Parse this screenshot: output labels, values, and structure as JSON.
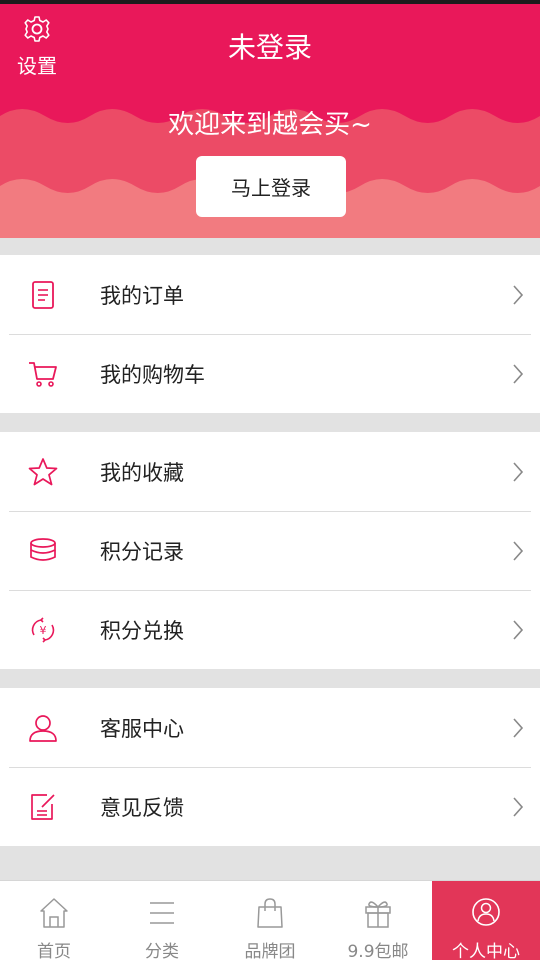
{
  "header": {
    "title": "未登录",
    "settings_label": "设置",
    "welcome": "欢迎来到越会买~",
    "login_button": "马上登录",
    "colors": {
      "primary": "#e9185a",
      "wave_mid": "#ec4b66",
      "wave_light": "#f27b80"
    }
  },
  "menu": {
    "group1": [
      {
        "label": "我的订单",
        "icon": "order-icon"
      },
      {
        "label": "我的购物车",
        "icon": "cart-icon"
      }
    ],
    "group2": [
      {
        "label": "我的收藏",
        "icon": "star-icon"
      },
      {
        "label": "积分记录",
        "icon": "coins-icon"
      },
      {
        "label": "积分兑换",
        "icon": "exchange-icon"
      }
    ],
    "group3": [
      {
        "label": "客服中心",
        "icon": "user-icon"
      },
      {
        "label": "意见反馈",
        "icon": "feedback-icon"
      }
    ]
  },
  "tabbar": {
    "items": [
      {
        "label": "首页",
        "icon": "home-icon",
        "active": false
      },
      {
        "label": "分类",
        "icon": "menu-icon",
        "active": false
      },
      {
        "label": "品牌团",
        "icon": "bag-icon",
        "active": false
      },
      {
        "label": "9.9包邮",
        "icon": "gift-icon",
        "active": false
      },
      {
        "label": "个人中心",
        "icon": "profile-icon",
        "active": true
      }
    ],
    "active_color": "#e23658"
  }
}
